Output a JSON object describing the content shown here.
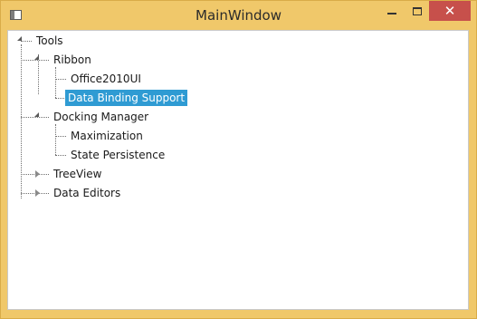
{
  "window": {
    "title": "MainWindow"
  },
  "controls": {
    "minimize": "—",
    "maximize": "☐",
    "close": "✕"
  },
  "tree": {
    "root": {
      "label": "Tools",
      "expanded": true
    },
    "items": [
      {
        "label": "Ribbon",
        "expanded": true
      },
      {
        "label": "Office2010UI"
      },
      {
        "label": "Data Binding Support",
        "selected": true
      },
      {
        "label": "Docking Manager",
        "expanded": true
      },
      {
        "label": "Maximization"
      },
      {
        "label": "State Persistence"
      },
      {
        "label": "TreeView",
        "expanded": false
      },
      {
        "label": "Data Editors",
        "expanded": false
      }
    ]
  },
  "colors": {
    "titlebar": "#f0c86a",
    "selection": "#2f9bd3",
    "close_button": "#c7504b"
  }
}
